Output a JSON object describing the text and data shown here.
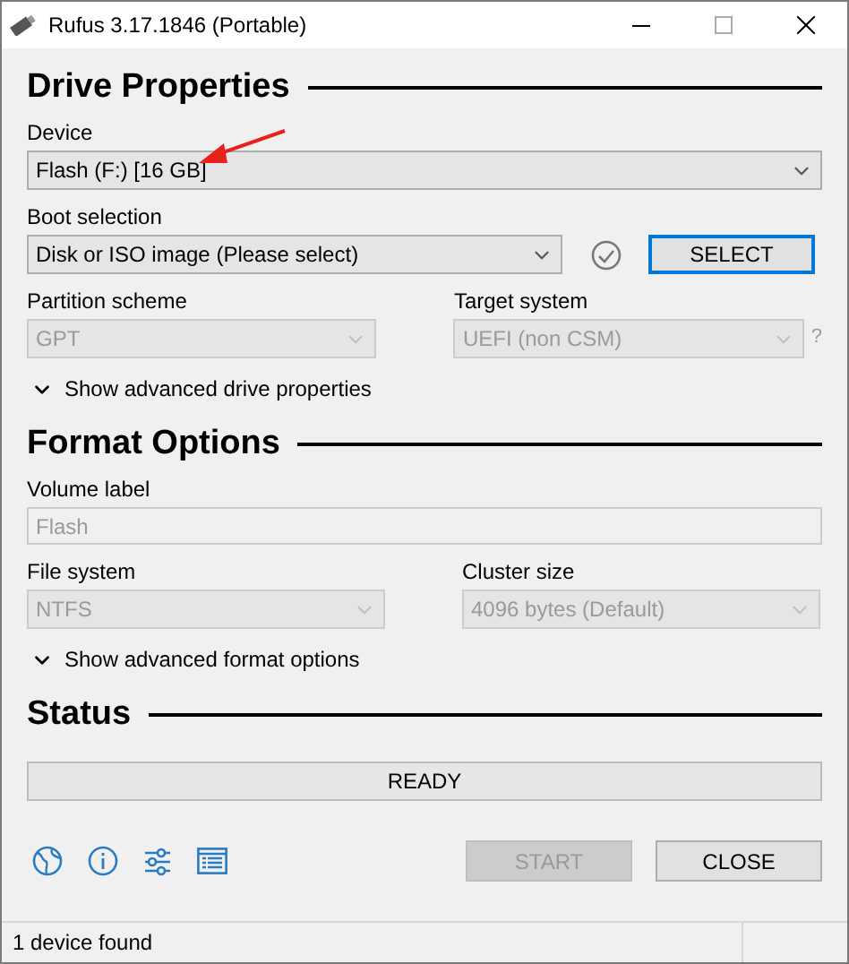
{
  "window": {
    "title": "Rufus 3.17.1846 (Portable)"
  },
  "drive_properties": {
    "heading": "Drive Properties",
    "device": {
      "label": "Device",
      "value": "Flash (F:) [16 GB]",
      "disabled": false
    },
    "boot_selection": {
      "label": "Boot selection",
      "value": "Disk or ISO image (Please select)",
      "disabled": false
    },
    "select_button": {
      "label": "SELECT",
      "focused": true
    },
    "partition_scheme": {
      "label": "Partition scheme",
      "value": "GPT",
      "disabled": true
    },
    "target_system": {
      "label": "Target system",
      "value": "UEFI (non CSM)",
      "disabled": true
    },
    "help_mark": "?",
    "advanced": {
      "label": "Show advanced drive properties",
      "expanded": false
    }
  },
  "format_options": {
    "heading": "Format Options",
    "volume_label": {
      "label": "Volume label",
      "value": "Flash",
      "disabled": true
    },
    "file_system": {
      "label": "File system",
      "value": "NTFS",
      "disabled": true
    },
    "cluster_size": {
      "label": "Cluster size",
      "value": "4096 bytes (Default)",
      "disabled": true
    },
    "advanced": {
      "label": "Show advanced format options",
      "expanded": false
    }
  },
  "status": {
    "heading": "Status",
    "progress": {
      "label": "READY"
    }
  },
  "buttons": [
    {
      "label": "START",
      "disabled": true
    },
    {
      "label": "CLOSE",
      "disabled": false
    }
  ],
  "status_bar": {
    "text": "1 device found"
  }
}
